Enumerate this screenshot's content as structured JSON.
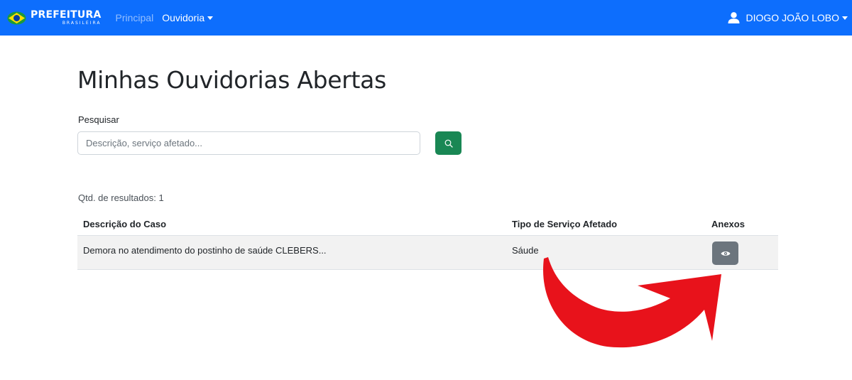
{
  "navbar": {
    "brand": "PREFEITURA",
    "brand_sub": "BRASILEIRA",
    "links": [
      "Principal",
      "Ouvidoria"
    ],
    "user_name": "DIOGO JOÃO LOBO"
  },
  "page": {
    "title": "Minhas Ouvidorias Abertas",
    "search_label": "Pesquisar",
    "search_placeholder": "Descrição, serviço afetado...",
    "search_value": "",
    "results_count": "Qtd. de resultados: 1"
  },
  "table": {
    "headers": [
      "Descrição do Caso",
      "Tipo de Serviço Afetado",
      "Anexos"
    ],
    "rows": [
      {
        "descricao": "Demora no atendimento do postinho de saúde CLEBERS...",
        "tipo": "Sáude"
      }
    ]
  },
  "colors": {
    "navbar": "#0d6efd",
    "search_button": "#198754",
    "view_button": "#6c757d",
    "annotation_arrow": "#e8121b"
  }
}
